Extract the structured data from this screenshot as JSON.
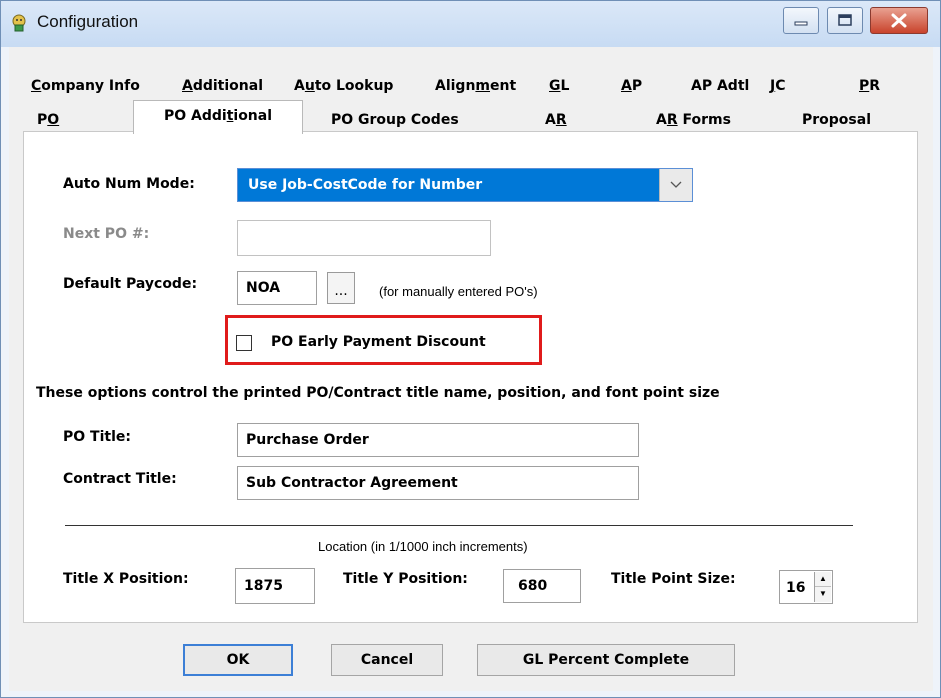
{
  "window": {
    "title": "Configuration"
  },
  "tabs": {
    "row1": [
      {
        "pre": "",
        "u": "C",
        "post": "ompany Info"
      },
      {
        "pre": "",
        "u": "A",
        "post": "dditional"
      },
      {
        "pre": "A",
        "u": "u",
        "post": "to Lookup"
      },
      {
        "pre": "Align",
        "u": "m",
        "post": "ent"
      },
      {
        "pre": "",
        "u": "G",
        "post": "L"
      },
      {
        "pre": "",
        "u": "A",
        "post": "P"
      },
      {
        "pre": "AP Adtl",
        "u": "",
        "post": ""
      },
      {
        "pre": "",
        "u": "J",
        "post": "C"
      },
      {
        "pre": "",
        "u": "P",
        "post": "R"
      }
    ],
    "row2": [
      {
        "pre": "P",
        "u": "O",
        "post": ""
      },
      {
        "pre": "PO Addi",
        "u": "t",
        "post": "ional"
      },
      {
        "pre": "PO Group Codes",
        "u": "",
        "post": ""
      },
      {
        "pre": "A",
        "u": "R",
        "post": ""
      },
      {
        "pre": "A",
        "u": "R",
        "post": " Forms"
      },
      {
        "pre": "Proposal",
        "u": "",
        "post": ""
      }
    ]
  },
  "form": {
    "auto_num_label": "Auto Num Mode:",
    "auto_num_value": "Use Job-CostCode for Number",
    "next_po_label": "Next PO #:",
    "next_po_value": "",
    "paycode_label": "Default Paycode:",
    "paycode_value": "NOA",
    "paycode_browse": "...",
    "paycode_note": "(for manually entered PO's)",
    "early_discount_label": "PO Early Payment Discount",
    "early_discount_checked": false,
    "options_heading": "These options control the printed PO/Contract title name, position, and font point size",
    "po_title_label": "PO Title:",
    "po_title_value": "Purchase Order",
    "contract_title_label": "Contract Title:",
    "contract_title_value": "Sub Contractor Agreement",
    "location_note": "Location (in 1/1000 inch increments)",
    "title_x_label": "Title X Position:",
    "title_x_value": "1875",
    "title_y_label": "Title Y Position:",
    "title_y_value": "680",
    "point_size_label": "Title Point Size:",
    "point_size_value": "16"
  },
  "buttons": {
    "ok": "OK",
    "cancel": "Cancel",
    "gl_percent": "GL Percent Complete"
  },
  "colors": {
    "highlight_box": "#e01b1b",
    "dropdown_selected": "#0078d7",
    "close_button": "#c9432c"
  },
  "icons": {
    "app": "config-app-icon",
    "minimize": "minimize-icon",
    "maximize": "maximize-icon",
    "close": "close-icon",
    "dropdown": "chevron-down-icon"
  }
}
